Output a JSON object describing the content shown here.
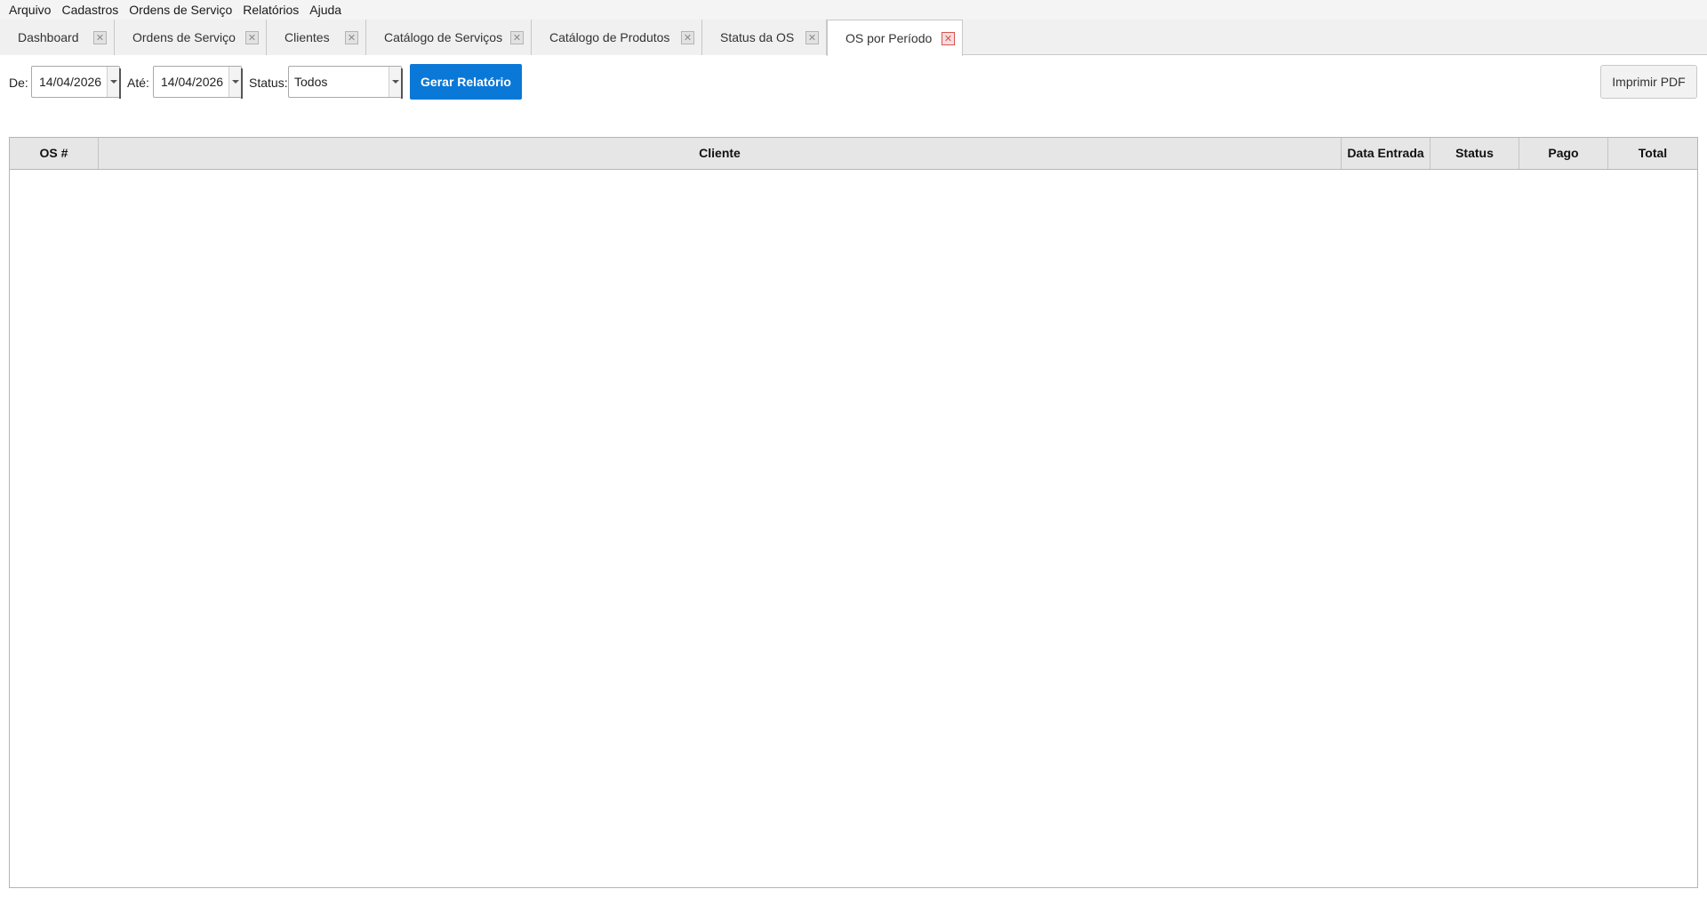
{
  "menu": {
    "items": [
      "Arquivo",
      "Cadastros",
      "Ordens de Serviço",
      "Relatórios",
      "Ajuda"
    ]
  },
  "tabs": [
    {
      "label": "Dashboard",
      "active": false
    },
    {
      "label": "Ordens de Serviço",
      "active": false
    },
    {
      "label": "Clientes",
      "active": false
    },
    {
      "label": "Catálogo de Serviços",
      "active": false
    },
    {
      "label": "Catálogo de Produtos",
      "active": false
    },
    {
      "label": "Status da OS",
      "active": false
    },
    {
      "label": "OS por Período",
      "active": true
    }
  ],
  "filters": {
    "from_label": "De:",
    "from_value": "14/04/2026",
    "to_label": "Até:",
    "to_value": "14/04/2026",
    "status_label": "Status:",
    "status_value": "Todos",
    "generate_button": "Gerar Relatório",
    "print_button": "Imprimir PDF"
  },
  "table": {
    "columns": [
      "OS #",
      "Cliente",
      "Data Entrada",
      "Status",
      "Pago",
      "Total"
    ],
    "rows": []
  },
  "colors": {
    "accent": "#0a78d7",
    "close_active": "#d9534f"
  },
  "icons": {
    "tab_close": "close-icon",
    "dropdown": "chevron-down-icon"
  }
}
